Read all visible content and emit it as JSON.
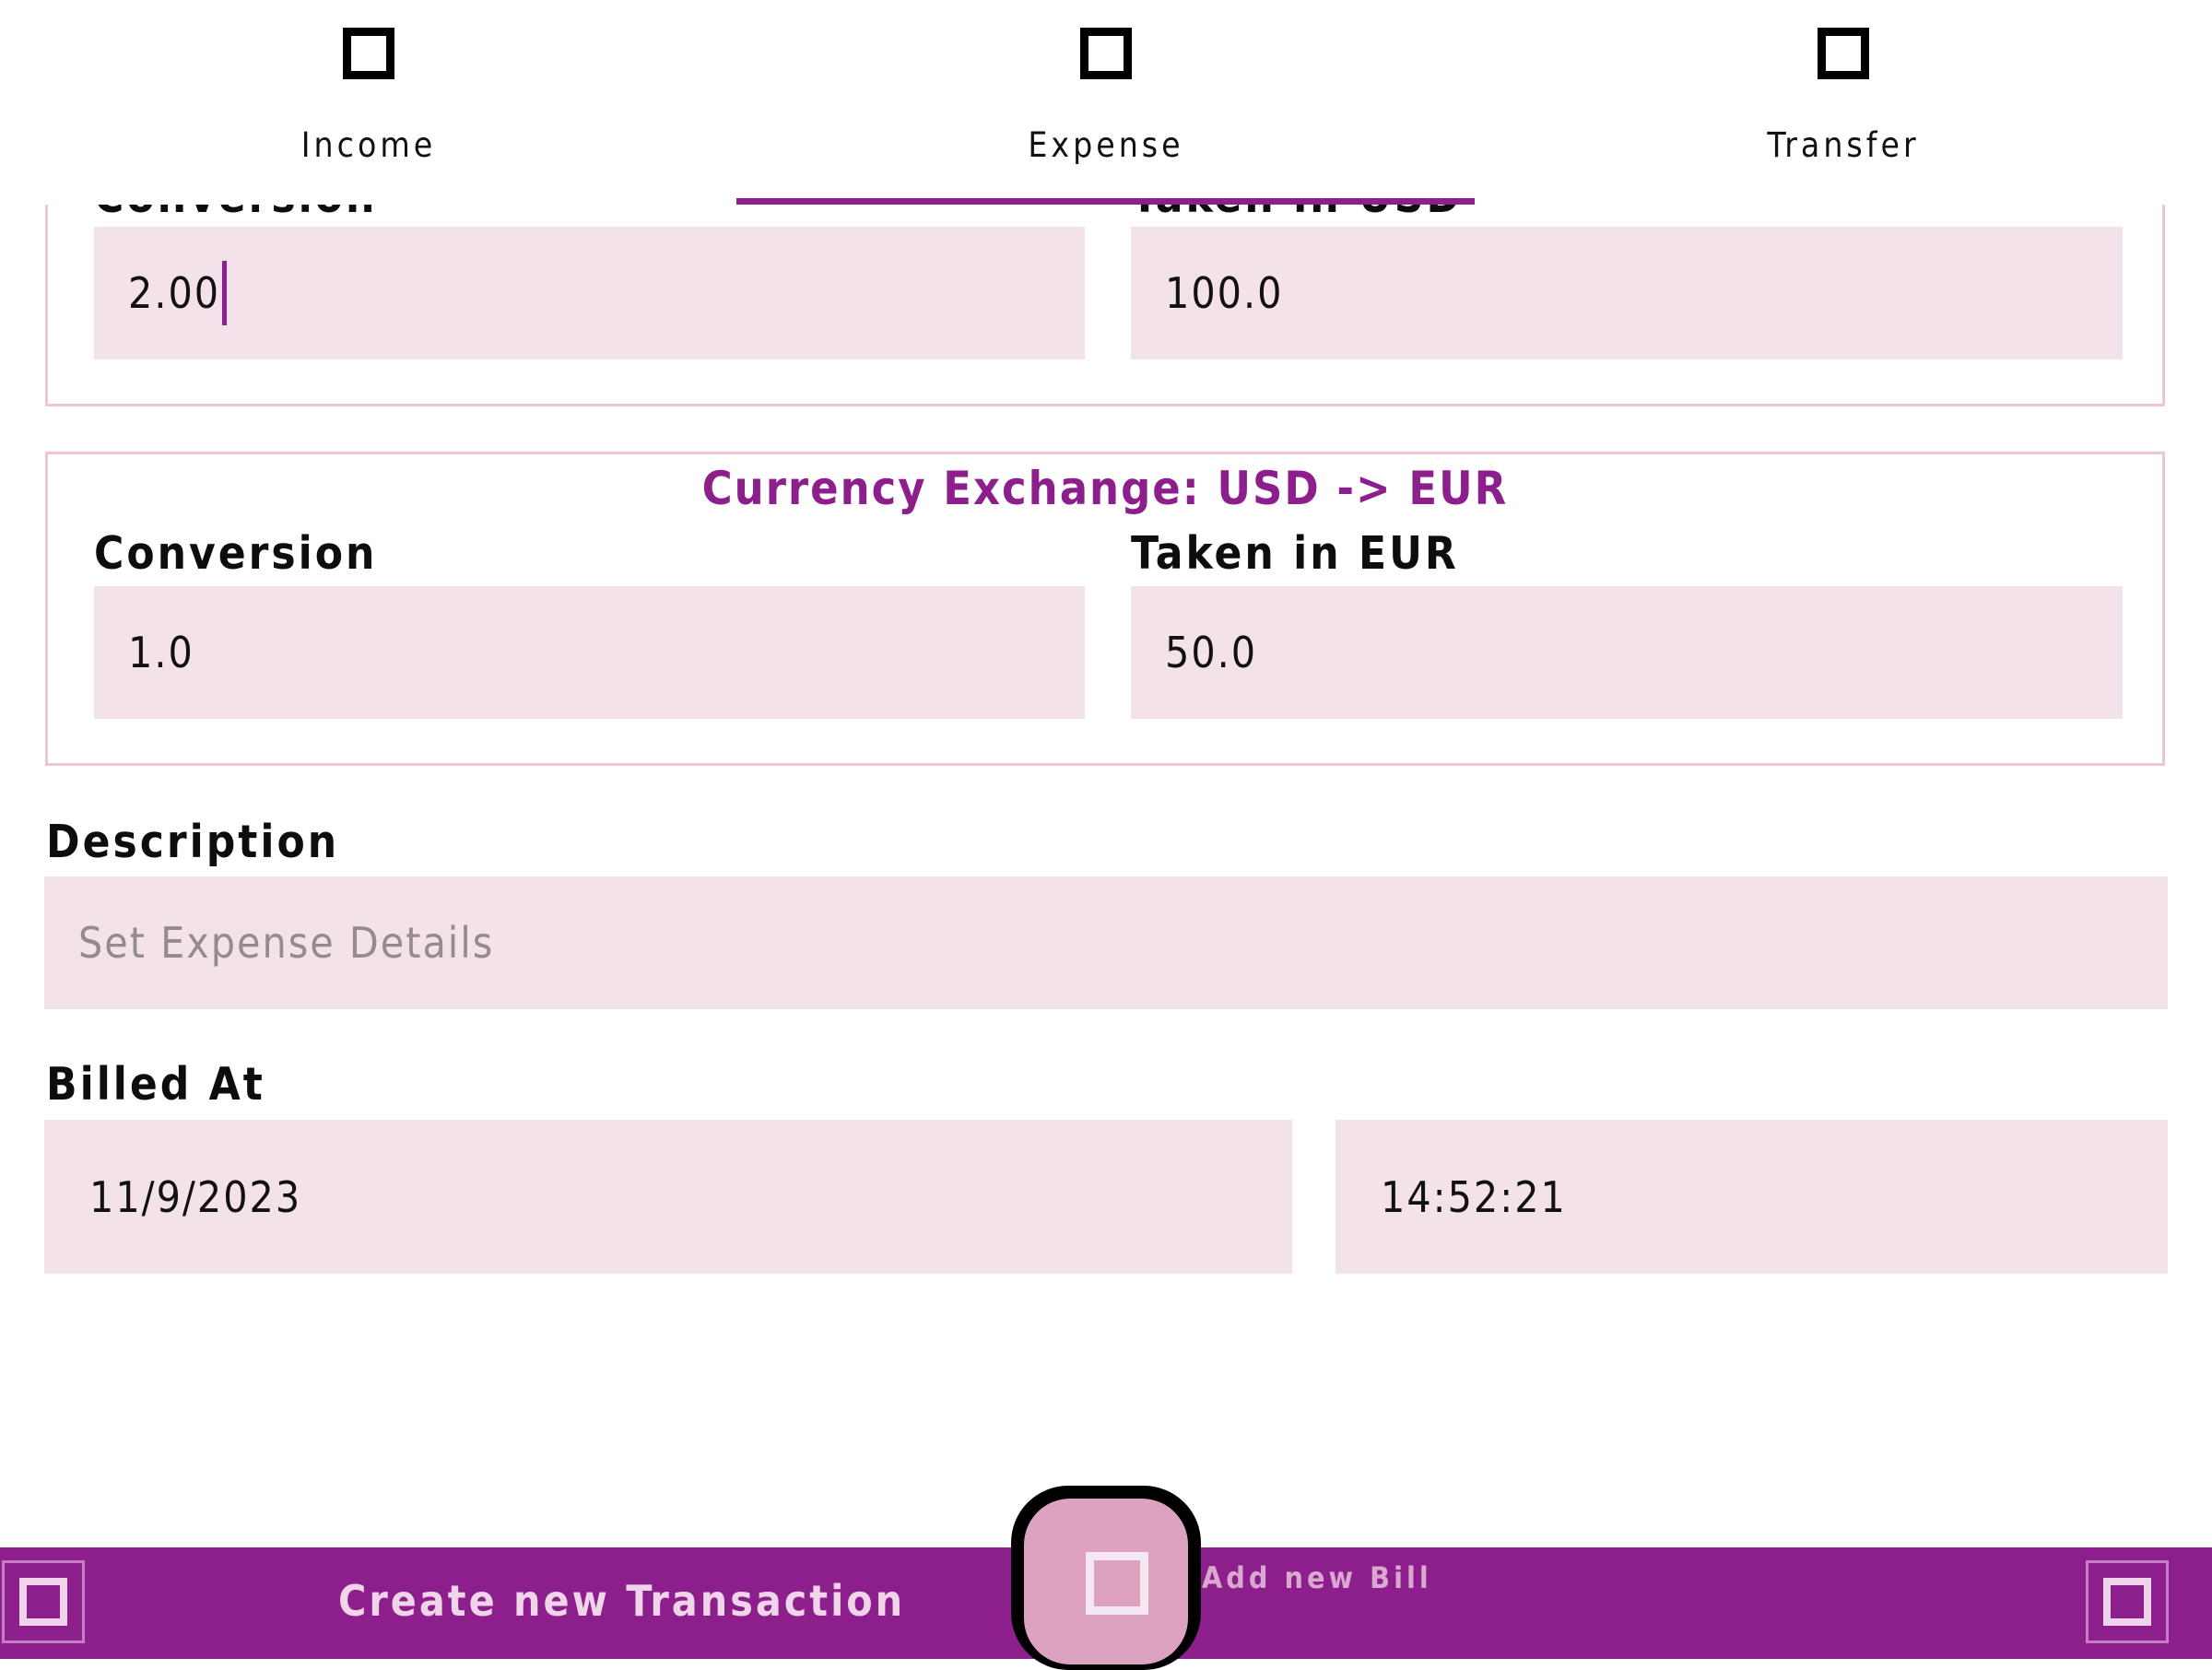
{
  "tabs": [
    {
      "label": "Income",
      "icon": "square-icon"
    },
    {
      "label": "Expense",
      "icon": "square-icon",
      "selected": true
    },
    {
      "label": "Transfer",
      "icon": "square-icon"
    }
  ],
  "exchange_usd": {
    "conversion_label": "Conversion",
    "taken_label": "Taken in USD",
    "conversion_value": "2.00",
    "taken_value": "100.0"
  },
  "exchange_eur": {
    "title": "Currency Exchange: USD -> EUR",
    "conversion_label": "Conversion",
    "taken_label": "Taken in EUR",
    "conversion_value": "1.0",
    "taken_value": "50.0"
  },
  "description": {
    "label": "Description",
    "placeholder": "Set Expense Details"
  },
  "billed_at": {
    "label": "Billed At",
    "date": "11/9/2023",
    "time": "14:52:21"
  },
  "bottom_bar": {
    "title": "Create new Transaction",
    "fab_label": "Add new Bill"
  },
  "colors": {
    "accent": "#8d1f8d",
    "field_bg": "#f4e2ea",
    "fab_bg": "#dca2c0"
  }
}
